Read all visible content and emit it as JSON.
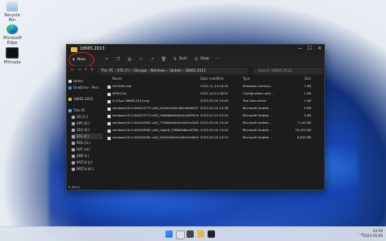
{
  "desktop": {
    "icons": [
      {
        "id": "recycle",
        "label": "Recycle Bin"
      },
      {
        "id": "edge",
        "label": "Microsoft Edge"
      },
      {
        "id": "screenshot",
        "label": "ffffmade"
      }
    ]
  },
  "window": {
    "title": "18665.2013",
    "controls": {
      "minimize": "—",
      "maximize": "☐",
      "close": "✕"
    }
  },
  "cmdbar": {
    "new_label": "New",
    "sort_label": "Sort",
    "view_label": "View",
    "more": "⋯"
  },
  "address": {
    "path": "This PC  ›  STE (F:)  ›  Storage  ›  Windows  ›  Update  ›  18665.2013",
    "search_placeholder": "Search 18665.2013"
  },
  "navpane": {
    "items": [
      {
        "label": "Home"
      },
      {
        "label": "OneDrive - Pers"
      },
      {
        "label": "18665.2013"
      },
      {
        "label": "This PC"
      },
      {
        "label": "OS (C:)"
      },
      {
        "label": "APP (D:)"
      },
      {
        "label": "ZEA (E:)"
      },
      {
        "label": "STE (F:)"
      },
      {
        "label": "PDS (G:)"
      },
      {
        "label": "DAT (H:)"
      },
      {
        "label": "SMP (I:)"
      },
      {
        "label": "PATCH (J:)"
      },
      {
        "label": "PATCH (K:)"
      }
    ]
  },
  "table": {
    "headers": {
      "name": "Name",
      "date": "Date modified",
      "type": "Type",
      "size": "Size"
    },
    "rows": [
      {
        "name": "rtf1026.cmd",
        "date": "2022-11-14 04:00",
        "type": "Windows Comma...",
        "size": "7 KB"
      },
      {
        "name": "NFM4.txt",
        "date": "2022-10-14 06:57",
        "type": "Configuration sett...",
        "size": "1 KB"
      },
      {
        "name": "4-1Opx-18665.2013.log",
        "date": "2023-05-05 14:43",
        "type": "Text Document",
        "size": "1 KB"
      },
      {
        "name": "windows10.0-kb5023773-x64_b10fac5b5fc0b2c6b9b97f0d2583c1f1b8b0f1f7.msu",
        "date": "2023-05-05 14:38",
        "type": "Microsoft Update ...",
        "size": "5 KB"
      },
      {
        "name": "windows10.0-kb5023773-x64_25b8b6b4b0b0c0d0f0c0a0b0f0c0d0f1.msu",
        "date": "2023-07-24 23:23",
        "type": "Microsoft Update ...",
        "size": "3 KB"
      },
      {
        "name": "windows10.0-kb5026361-x64_77b8b0b4b0c0e0f1e0d0f0c0b0a0c0d0.msu",
        "date": "2023-05-05 14:44",
        "type": "Microsoft Update ...",
        "size": "7,140 KB"
      },
      {
        "name": "windows10.0-kb5026361-x64_ndp48_25f8b0b6bc0f29b0ee73ecd9b6d6ba8d.msu",
        "date": "2023-05-05 14:44",
        "type": "Microsoft Update ...",
        "size": "76,420 KB"
      },
      {
        "name": "windows10.0-kb5026361-x64_5b5f0d0e0f1a0b0c0d0e0f1a2b3c4d5e.msu",
        "date": "2023-05-05 14:31",
        "type": "Microsoft Update ...",
        "size": "6,810 KB"
      }
    ]
  },
  "status": {
    "text": "8 items"
  },
  "taskbar": {
    "time": "03:56",
    "date": "2023-05-06"
  }
}
